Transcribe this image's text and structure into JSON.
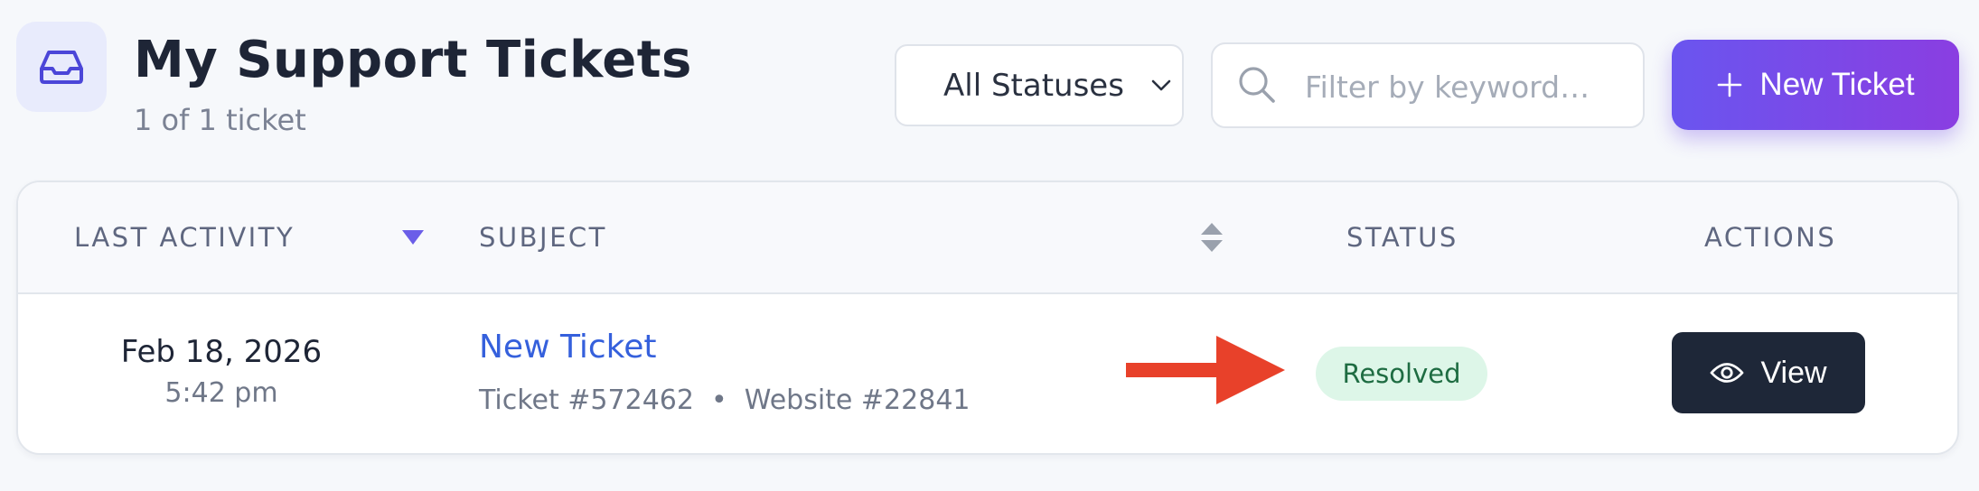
{
  "header": {
    "icon": "inbox-icon",
    "title": "My Support Tickets",
    "subtitle": "1 of 1 ticket"
  },
  "filters": {
    "status_select": {
      "value": "All Statuses",
      "icon": "chevron-down-icon"
    },
    "search": {
      "placeholder": "Filter by keyword…",
      "value": "",
      "icon": "search-icon"
    },
    "new_ticket_button": {
      "label": "New Ticket",
      "icon": "plus-icon",
      "gradient": [
        "#6a55ef",
        "#8a3ee1"
      ]
    }
  },
  "table": {
    "columns": [
      {
        "label": "LAST ACTIVITY",
        "sort": "descending",
        "sort_icon": "sort-desc-icon"
      },
      {
        "label": "SUBJECT",
        "sort": "sortable",
        "sort_icon": "sort-icon"
      },
      {
        "label": "STATUS"
      },
      {
        "label": "ACTIONS"
      }
    ],
    "rows": [
      {
        "date": "Feb 18, 2026",
        "time": "5:42 pm",
        "subject": "New Ticket",
        "meta": "Ticket #572462  •  Website #22841",
        "status": "Resolved",
        "action_label": "View",
        "action_icon": "eye-icon"
      }
    ]
  },
  "annotation": {
    "icon": "red-arrow-icon",
    "color": "#e8412a"
  },
  "colors": {
    "accent": "#6a55ef",
    "sort_active": "#6b5ee8",
    "link": "#3560dc",
    "status_resolved_bg": "#ddf6e8",
    "status_resolved_text": "#1e6c42",
    "dark_button": "#1e2738"
  }
}
